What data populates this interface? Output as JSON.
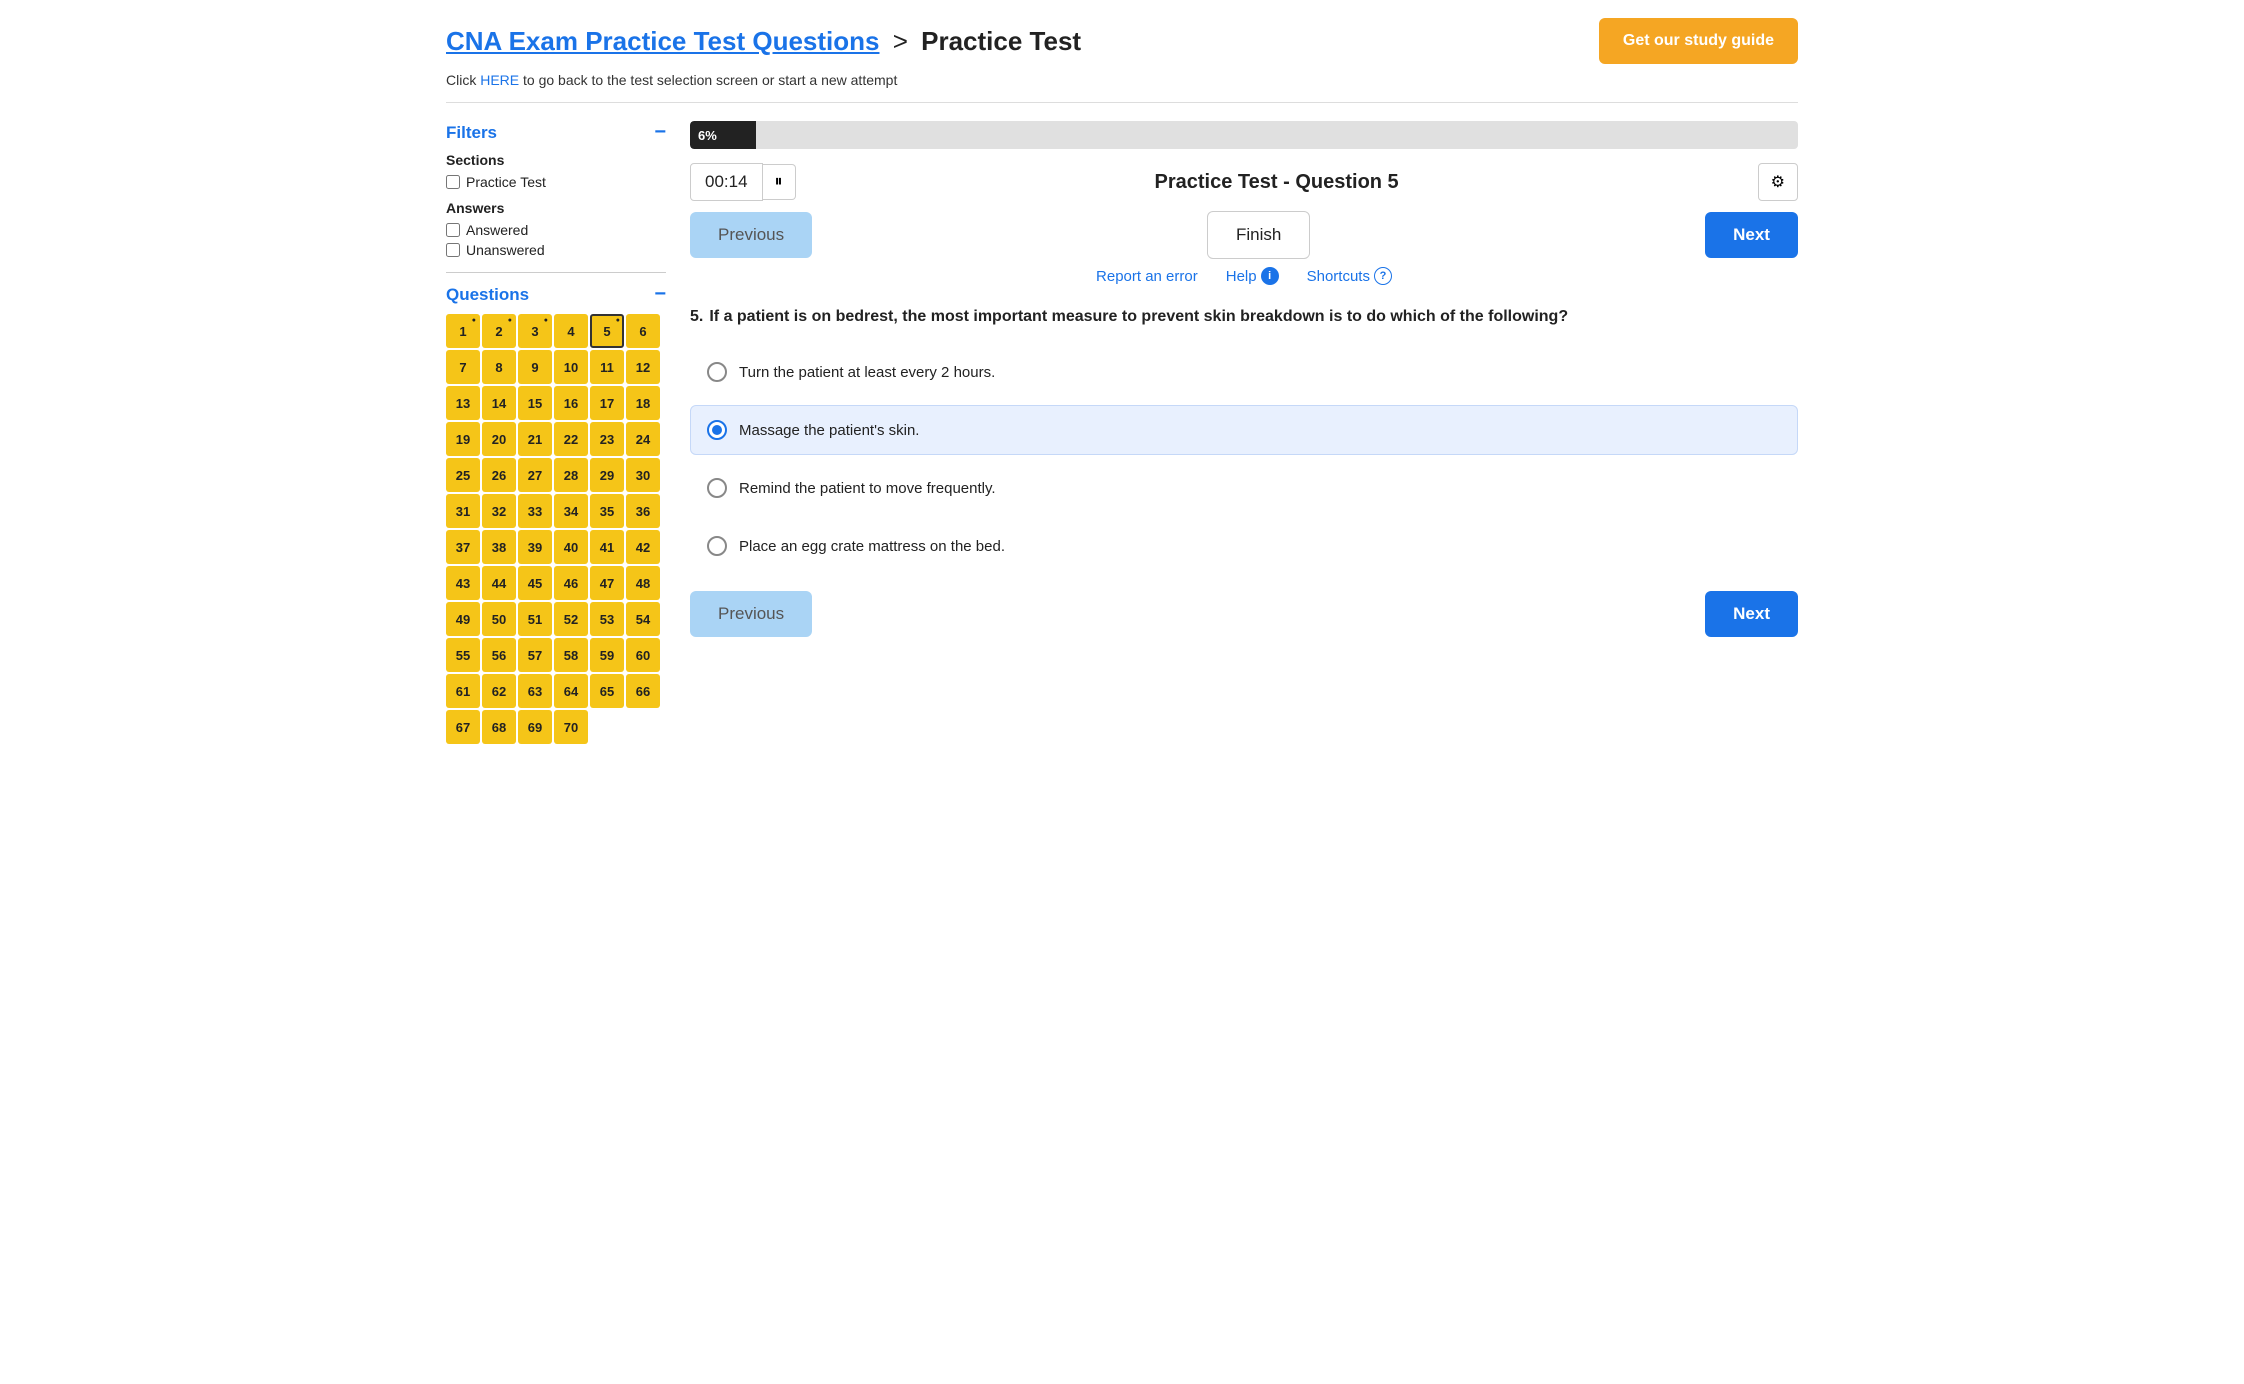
{
  "header": {
    "cna_link_label": "CNA Exam Practice Test Questions",
    "separator": ">",
    "practice_test_label": "Practice Test",
    "study_guide_btn": "Get our study guide"
  },
  "subtitle": {
    "text": "Click ",
    "link_text": "HERE",
    "rest": " to go back to the test selection screen or start a new attempt"
  },
  "sidebar": {
    "filters_label": "Filters",
    "sections_label": "Sections",
    "practice_test_checkbox": "Practice Test",
    "answers_label": "Answers",
    "answered_checkbox": "Answered",
    "unanswered_checkbox": "Unanswered",
    "questions_label": "Questions",
    "questions": [
      {
        "num": 1,
        "dot": true
      },
      {
        "num": 2,
        "dot": true
      },
      {
        "num": 3,
        "dot": true
      },
      {
        "num": 4,
        "dot": false
      },
      {
        "num": 5,
        "dot": true,
        "active": true
      },
      {
        "num": 6,
        "dot": false
      },
      {
        "num": 7,
        "dot": false
      },
      {
        "num": 8,
        "dot": false
      },
      {
        "num": 9,
        "dot": false
      },
      {
        "num": 10,
        "dot": false
      },
      {
        "num": 11,
        "dot": false
      },
      {
        "num": 12,
        "dot": false
      },
      {
        "num": 13,
        "dot": false
      },
      {
        "num": 14,
        "dot": false
      },
      {
        "num": 15,
        "dot": false
      },
      {
        "num": 16,
        "dot": false
      },
      {
        "num": 17,
        "dot": false
      },
      {
        "num": 18,
        "dot": false
      },
      {
        "num": 19,
        "dot": false
      },
      {
        "num": 20,
        "dot": false
      },
      {
        "num": 21,
        "dot": false
      },
      {
        "num": 22,
        "dot": false
      },
      {
        "num": 23,
        "dot": false
      },
      {
        "num": 24,
        "dot": false
      },
      {
        "num": 25,
        "dot": false
      },
      {
        "num": 26,
        "dot": false
      },
      {
        "num": 27,
        "dot": false
      },
      {
        "num": 28,
        "dot": false
      },
      {
        "num": 29,
        "dot": false
      },
      {
        "num": 30,
        "dot": false
      },
      {
        "num": 31,
        "dot": false
      },
      {
        "num": 32,
        "dot": false
      },
      {
        "num": 33,
        "dot": false
      },
      {
        "num": 34,
        "dot": false
      },
      {
        "num": 35,
        "dot": false
      },
      {
        "num": 36,
        "dot": false
      },
      {
        "num": 37,
        "dot": false
      },
      {
        "num": 38,
        "dot": false
      },
      {
        "num": 39,
        "dot": false
      },
      {
        "num": 40,
        "dot": false
      },
      {
        "num": 41,
        "dot": false
      },
      {
        "num": 42,
        "dot": false
      },
      {
        "num": 43,
        "dot": false
      },
      {
        "num": 44,
        "dot": false
      },
      {
        "num": 45,
        "dot": false
      },
      {
        "num": 46,
        "dot": false
      },
      {
        "num": 47,
        "dot": false
      },
      {
        "num": 48,
        "dot": false
      },
      {
        "num": 49,
        "dot": false
      },
      {
        "num": 50,
        "dot": false
      },
      {
        "num": 51,
        "dot": false
      },
      {
        "num": 52,
        "dot": false
      },
      {
        "num": 53,
        "dot": false
      },
      {
        "num": 54,
        "dot": false
      },
      {
        "num": 55,
        "dot": false
      },
      {
        "num": 56,
        "dot": false
      },
      {
        "num": 57,
        "dot": false
      },
      {
        "num": 58,
        "dot": false
      },
      {
        "num": 59,
        "dot": false
      },
      {
        "num": 60,
        "dot": false
      },
      {
        "num": 61,
        "dot": false
      },
      {
        "num": 62,
        "dot": false
      },
      {
        "num": 63,
        "dot": false
      },
      {
        "num": 64,
        "dot": false
      },
      {
        "num": 65,
        "dot": false
      },
      {
        "num": 66,
        "dot": false
      },
      {
        "num": 67,
        "dot": false
      },
      {
        "num": 68,
        "dot": false
      },
      {
        "num": 69,
        "dot": false
      },
      {
        "num": 70,
        "dot": false
      }
    ]
  },
  "content": {
    "progress_percent": "6%",
    "progress_width": "6",
    "timer": "00:14",
    "question_title": "Practice Test - Question 5",
    "prev_btn": "Previous",
    "next_btn": "Next",
    "finish_btn": "Finish",
    "report_error_link": "Report an error",
    "help_link": "Help",
    "shortcuts_link": "Shortcuts",
    "question_num": "5.",
    "question_text": "If a patient is on bedrest, the most important measure to prevent skin breakdown is to do which of the following?",
    "answers": [
      {
        "id": "a",
        "text": "Turn the patient at least every 2 hours.",
        "selected": false
      },
      {
        "id": "b",
        "text": "Massage the patient's skin.",
        "selected": true
      },
      {
        "id": "c",
        "text": "Remind the patient to move frequently.",
        "selected": false
      },
      {
        "id": "d",
        "text": "Place an egg crate mattress on the bed.",
        "selected": false
      }
    ]
  }
}
